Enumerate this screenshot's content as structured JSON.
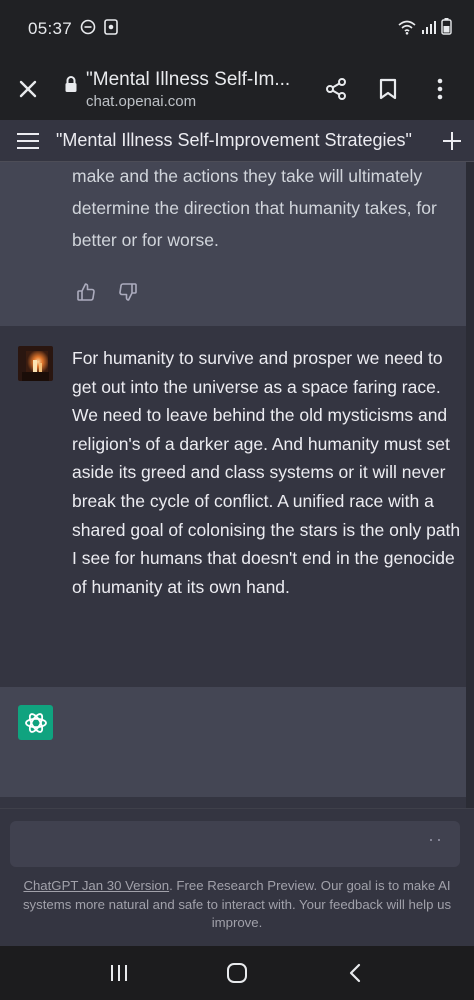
{
  "status_bar": {
    "time": "05:37"
  },
  "browser": {
    "page_title": "\"Mental Illness Self-Im...",
    "url": "chat.openai.com"
  },
  "chat_header": {
    "title": "\"Mental Illness Self-Improvement Strategies\""
  },
  "messages": {
    "assistant_prev": {
      "text": "make and the actions they take will ultimately determine the direction that humanity takes, for better or for worse."
    },
    "user": {
      "text": "For humanity to survive and prosper we need to get out into the universe as a space faring race. We need to leave behind the old mysticisms and religion's of a darker age. And humanity must set aside its greed and class systems or it will never break the cycle of conflict. A unified race with a shared goal of colonising the stars is the only path I see for humans that doesn't end in the genocide of humanity at its own hand."
    }
  },
  "input": {
    "typing_indicator": "··"
  },
  "footer": {
    "version_link": "ChatGPT Jan 30 Version",
    "disclaimer": ". Free Research Preview. Our goal is to make AI systems more natural and safe to interact with. Your feedback will help us improve."
  },
  "colors": {
    "accent": "#10a37f",
    "background": "#343541",
    "assistant_bg": "#444654"
  }
}
